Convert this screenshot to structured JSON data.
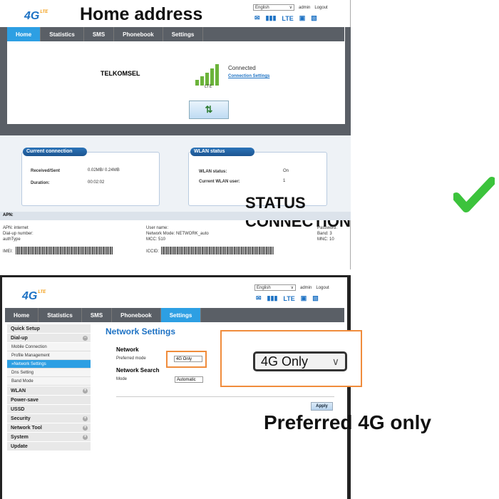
{
  "header": {
    "logo_text": "4G",
    "logo_sub": "LTE",
    "language": "English",
    "admin": "admin",
    "logout": "Logout",
    "lte": "LTE"
  },
  "annotations": {
    "home_address": "Home address",
    "status_connection": "STATUS CONNECTION",
    "preferred": "Preferred 4G only",
    "zoom_value": "4G Only"
  },
  "nav1": [
    "Home",
    "Statistics",
    "SMS",
    "Phonebook",
    "Settings"
  ],
  "nav2": [
    "Home",
    "Statistics",
    "SMS",
    "Phonebook",
    "Settings"
  ],
  "home": {
    "operator": "TELKOMSEL",
    "status": "Connected",
    "conn_settings": "Connection Settings",
    "signal_label": "LTE"
  },
  "current": {
    "title": "Current connection",
    "rs_label": "Received/Sent",
    "rs_value": "0.02MB/ 0.24MB",
    "dur_label": "Duration:",
    "dur_value": "00:02:02"
  },
  "wlan": {
    "title": "WLAN status",
    "status_label": "WLAN status:",
    "status_value": "On",
    "users_label": "Current WLAN user:",
    "users_value": "1"
  },
  "apn": {
    "title": "APN:",
    "apn_line": "APN: internet",
    "dial": "Dial-up number:",
    "auth": "authType",
    "user": "User name:",
    "mode": "Network Mode: NETWORK_auto",
    "mcc": "MCC: 510",
    "pwd": "Password:",
    "band": "Band:   3",
    "mnc": "MNC: 10",
    "imei": "IMEI:",
    "iccid": "ICCID:"
  },
  "sidebar": {
    "quick": "Quick Setup",
    "dialup": "Dial-up",
    "mobile": "Mobile Connection",
    "profile": "Profile Management",
    "netset": "»Network Settings",
    "dns": "Dns Setting",
    "band": "Band Mode",
    "wlan": "WLAN",
    "power": "Power-save",
    "ussd": "USSD",
    "security": "Security",
    "tool": "Network Tool",
    "system": "System",
    "update": "Update"
  },
  "settings": {
    "title": "Network Settings",
    "network": "Network",
    "pref_label": "Preferred mode",
    "pref_value": "4G Only",
    "search": "Network Search",
    "mode_label": "Mode",
    "mode_value": "Automatic",
    "apply": "Apply"
  },
  "colors": {
    "accent": "#2d9fe3",
    "nav": "#5a5f66",
    "highlight": "#f08c3c",
    "check": "#3cc33c"
  }
}
